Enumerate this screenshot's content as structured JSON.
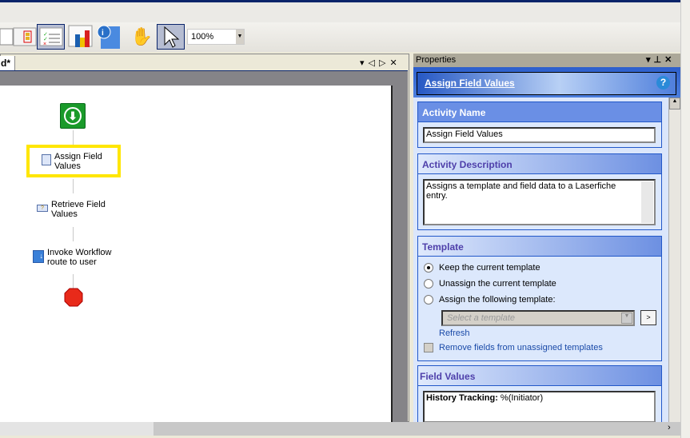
{
  "toolbar": {
    "zoom_value": "100%"
  },
  "document": {
    "tab_label": "d*"
  },
  "workflow": {
    "nodes": [
      {
        "label_line1": "Assign Field",
        "label_line2": "Values"
      },
      {
        "label_line1": "Retrieve Field",
        "label_line2": "Values"
      },
      {
        "label_line1": "Invoke Workflow",
        "label_line2": "route to user"
      }
    ]
  },
  "properties": {
    "panel_title": "Properties",
    "activity_title": "Assign Field Values",
    "help_label": "?",
    "activity_name": {
      "header": "Activity Name",
      "value": "Assign Field Values"
    },
    "activity_description": {
      "header": "Activity Description",
      "value": "Assigns a template and field data to a Laserfiche entry."
    },
    "template": {
      "header": "Template",
      "options": [
        "Keep the current template",
        "Unassign the current template",
        "Assign the following template:"
      ],
      "selected_index": 0,
      "select_placeholder": "Select a template",
      "go_label": ">",
      "refresh_label": "Refresh",
      "remove_fields_label": "Remove fields from unassigned templates",
      "remove_fields_checked": false
    },
    "field_values": {
      "header": "Field Values",
      "field_name": "History Tracking:",
      "field_value": "%(Initiator)"
    }
  },
  "colors": {
    "accent": "#2258c9",
    "highlight": "#ffe600"
  }
}
